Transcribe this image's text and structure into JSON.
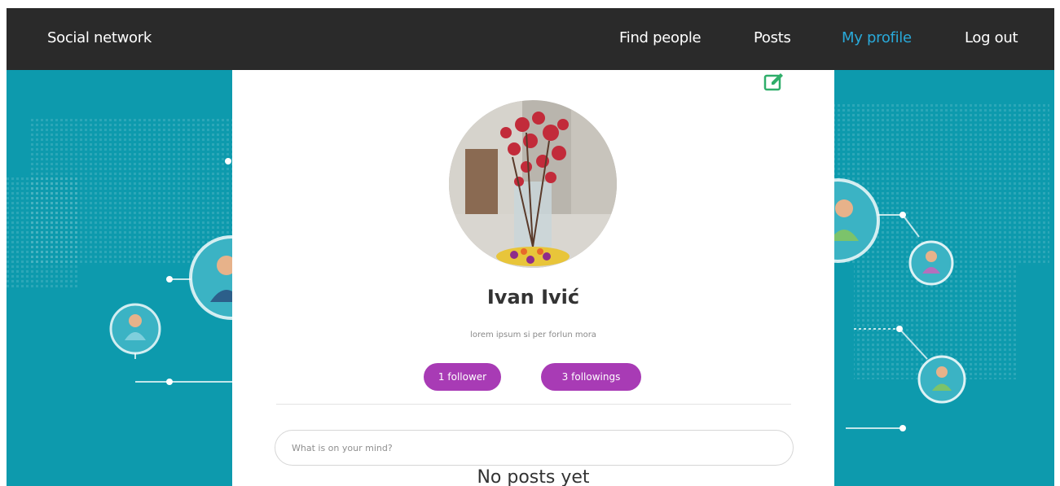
{
  "navbar": {
    "brand": "Social network",
    "links": [
      {
        "label": "Find people",
        "active": false
      },
      {
        "label": "Posts",
        "active": false
      },
      {
        "label": "My profile",
        "active": true
      },
      {
        "label": "Log out",
        "active": false
      }
    ]
  },
  "profile": {
    "name": "Ivan Ivić",
    "bio": "lorem ipsum si per forlun mora",
    "followers_label": "1 follower",
    "followings_label": "3 followings",
    "edit_icon": "edit-square-icon"
  },
  "composer": {
    "placeholder": "What is on your mind?"
  },
  "posts": {
    "empty_label": "No posts yet"
  },
  "colors": {
    "navbar_bg": "#2a2a2a",
    "active_link": "#29a9d9",
    "background": "#0d9aad",
    "pill": "#a83bb5",
    "edit_icon": "#2fae6a"
  }
}
